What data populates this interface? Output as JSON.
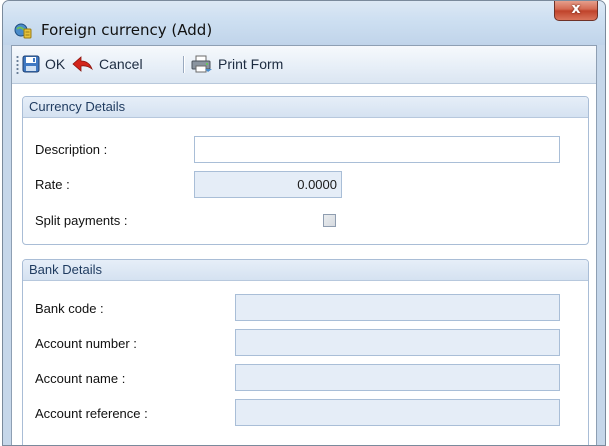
{
  "window": {
    "title": "Foreign currency (Add)",
    "close_label": "x"
  },
  "toolbar": {
    "ok_label": "OK",
    "cancel_label": "Cancel",
    "print_label": "Print Form"
  },
  "currency_details": {
    "header": "Currency Details",
    "description_label": "Description :",
    "description_value": "",
    "rate_label": "Rate :",
    "rate_value": "0.0000",
    "split_label": "Split payments :",
    "split_checked": false
  },
  "bank_details": {
    "header": "Bank Details",
    "bank_code_label": "Bank code :",
    "account_number_label": "Account number :",
    "account_name_label": "Account name :",
    "account_reference_label": "Account reference :"
  },
  "colors": {
    "title_bar": "#cddff1",
    "close_button": "#c0432b",
    "group_border": "#a9bdd6",
    "disabled_field": "#e5edf7"
  },
  "icons": [
    "app-icon",
    "save-icon",
    "back-arrow-icon",
    "print-icon",
    "close-icon"
  ]
}
